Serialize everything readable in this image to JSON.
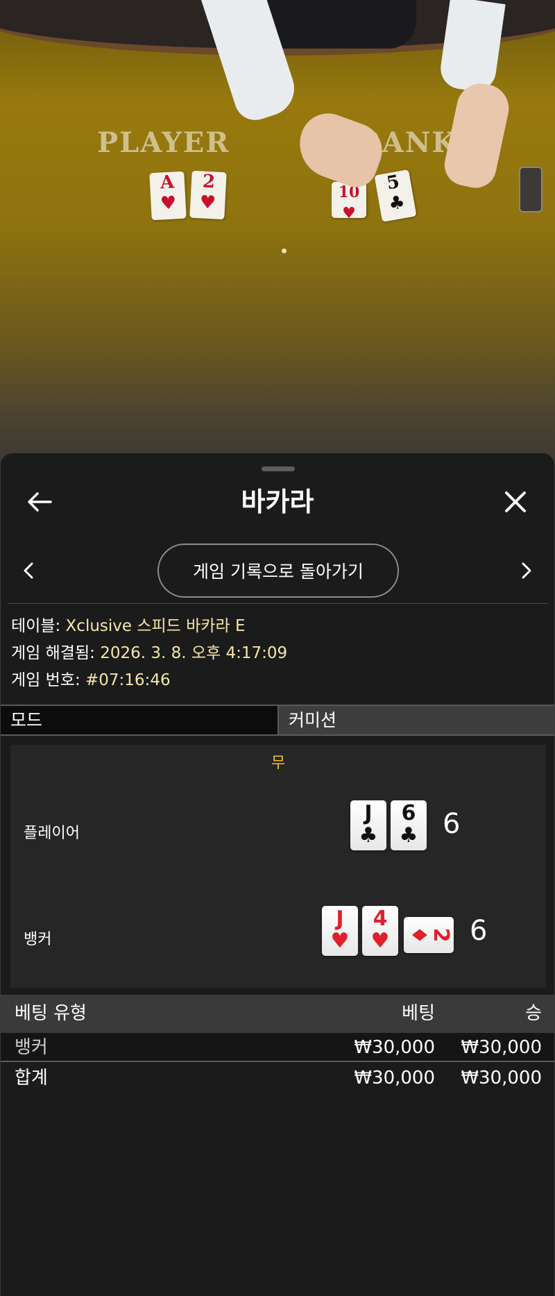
{
  "video": {
    "felt_player": "PLAYER",
    "felt_banker": "BANKE",
    "player_cards": [
      {
        "rank": "A",
        "suit": "♥",
        "color": "red"
      },
      {
        "rank": "2",
        "suit": "♥",
        "color": "red"
      }
    ],
    "banker_cards": [
      {
        "rank": "10",
        "suit": "♥",
        "color": "red"
      },
      {
        "rank": "5",
        "suit": "♣",
        "color": "black"
      }
    ]
  },
  "header": {
    "title": "바카라",
    "back_icon": "arrow-left-icon",
    "close_icon": "close-icon"
  },
  "nav": {
    "history_button": "게임 기록으로 돌아가기",
    "prev_icon": "chevron-left-icon",
    "next_icon": "chevron-right-icon"
  },
  "info": {
    "table_label": "테이블:",
    "table_value": "Xclusive 스피드 바카라 E",
    "resolved_label": "게임 해결됨:",
    "resolved_value": "2026. 3. 8. 오후 4:17:09",
    "game_no_label": "게임 번호:",
    "game_no_value": "#07:16:46"
  },
  "tabs": {
    "mode": "모드",
    "commission": "커미션"
  },
  "result": {
    "outcome": "무",
    "player": {
      "label": "플레이어",
      "score": "6",
      "cards": [
        {
          "rank": "J",
          "suit": "♣",
          "color": "black"
        },
        {
          "rank": "6",
          "suit": "♣",
          "color": "black"
        }
      ]
    },
    "banker": {
      "label": "뱅커",
      "score": "6",
      "cards": [
        {
          "rank": "J",
          "suit": "♥",
          "color": "red"
        },
        {
          "rank": "4",
          "suit": "♥",
          "color": "red"
        },
        {
          "rank": "2",
          "suit": "♦",
          "color": "red",
          "sideways": true
        }
      ]
    }
  },
  "bets": {
    "headers": {
      "type": "베팅 유형",
      "bet": "베팅",
      "win": "승"
    },
    "rows": [
      {
        "type": "뱅커",
        "bet": "₩30,000",
        "win": "₩30,000"
      }
    ],
    "total": {
      "type": "합계",
      "bet": "₩30,000",
      "win": "₩30,000"
    }
  },
  "colors": {
    "accent_value": "#f7e7a7",
    "outcome": "#f0c12a",
    "sheet_bg": "#1b1b1b"
  }
}
